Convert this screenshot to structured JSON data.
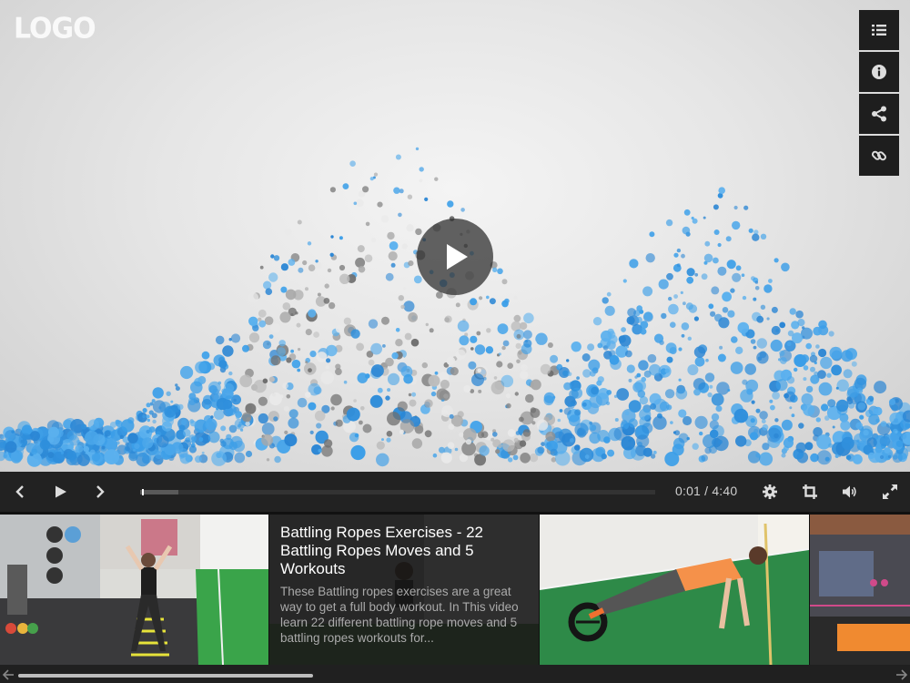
{
  "player": {
    "logo": "LOGO",
    "side_menu": [
      {
        "id": "playlist",
        "icon": "list-icon"
      },
      {
        "id": "info",
        "icon": "info-icon"
      },
      {
        "id": "share",
        "icon": "share-icon"
      },
      {
        "id": "link",
        "icon": "link-icon"
      }
    ],
    "big_play_icon": "play-icon",
    "accent_color": "#3b9ee8"
  },
  "controls": {
    "prev_icon": "chevron-left-icon",
    "play_icon": "play-icon",
    "next_icon": "chevron-right-icon",
    "time_display": "0:01 / 4:40",
    "buffered_fraction": 0.075,
    "played_fraction": 0.004,
    "right_icons": [
      "gear-icon",
      "crop-icon",
      "volume-icon",
      "fullscreen-icon"
    ]
  },
  "playlist": {
    "items": [
      {
        "id": "item-1",
        "thumb": "gym-ladder-drill"
      },
      {
        "id": "item-2",
        "thumb": "battling-ropes",
        "title": "Battling Ropes Exercises - 22 Battling Ropes Moves and 5 Workouts",
        "description": "These Battling ropes exercises are a great way to get a full body workout. In This video learn 22 different battling rope moves and 5 battling ropes workouts for..."
      },
      {
        "id": "item-3",
        "thumb": "ab-wheel-rollout"
      },
      {
        "id": "item-4",
        "thumb": "gym-interior"
      }
    ],
    "scroll_fraction": 0.0
  }
}
